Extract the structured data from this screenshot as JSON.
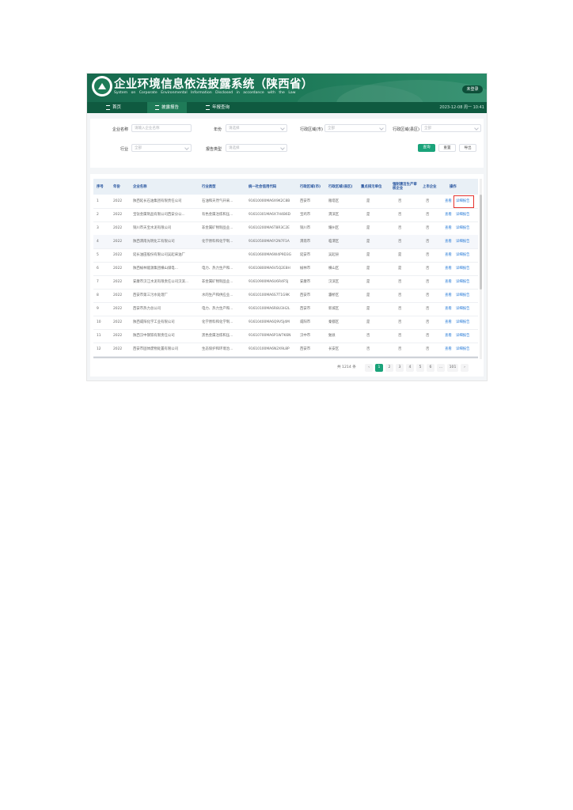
{
  "header": {
    "title": "企业环境信息依法披露系统（陕西省）",
    "subtitle": "System on Corporate Environmental Information Disclosed in accordance with the Law",
    "login_label": "未登录"
  },
  "nav": {
    "items": [
      {
        "label": "首页",
        "active": false
      },
      {
        "label": "披露报告",
        "active": true
      },
      {
        "label": "年报查询",
        "active": false
      }
    ],
    "datetime": "2023-12-08 周一 10:41"
  },
  "filters": {
    "company_name_label": "企业名称",
    "company_name_placeholder": "请输入企业名称",
    "year_label": "年份",
    "year_value": "请选择",
    "region_city_label": "行政区域(市)",
    "region_city_value": "全部",
    "region_county_label": "行政区域(县区)",
    "region_county_value": "全部",
    "industry_label": "行业",
    "industry_value": "全部",
    "report_type_label": "报告类型",
    "report_type_value": "请选择",
    "search_button": "查询",
    "reset_button": "重置",
    "export_button": "导出"
  },
  "table": {
    "columns": [
      "序号",
      "年份",
      "企业名称",
      "行业类型",
      "统一社会信用代码",
      "行政区域(市)",
      "行政区域(县区)",
      "重点排污单位",
      "强制清洁生产审核企业",
      "上市企业",
      "操作"
    ],
    "op_view": "查看",
    "op_detail": "详细报告",
    "rows": [
      {
        "no": "1",
        "year": "2022",
        "name": "陕西延长石油集团有限责任公司",
        "industry": "石油和天然气开采...",
        "code": "91610000MA6X9K2C8B",
        "city": "西安市",
        "county": "雁塔区",
        "key": "是",
        "clean": "否",
        "listed": "否"
      },
      {
        "no": "2",
        "year": "2022",
        "name": "宝钛金属制品有限公司西安分公...",
        "industry": "有色金属冶炼和压...",
        "code": "91610301MA6X7H4B6D",
        "city": "宝鸡市",
        "county": "渭滨区",
        "key": "是",
        "clean": "否",
        "listed": "否"
      },
      {
        "no": "3",
        "year": "2022",
        "name": "铜川市天宝水泥有限公司",
        "industry": "非金属矿物制品业...",
        "code": "91610200MA6T8R3C2E",
        "city": "铜川市",
        "county": "耀州区",
        "key": "是",
        "clean": "否",
        "listed": "否"
      },
      {
        "no": "4",
        "year": "2022",
        "name": "陕西渭南光明化工有限公司",
        "industry": "化学原料和化学制...",
        "code": "91610500MA6Y2N7F1A",
        "city": "渭南市",
        "county": "临渭区",
        "key": "是",
        "clean": "否",
        "listed": "否"
      },
      {
        "no": "5",
        "year": "2022",
        "name": "延长油田股份有限公司吴起采油厂",
        "industry": "",
        "code": "91610600MA6W4P9D3G",
        "city": "延安市",
        "county": "吴起县",
        "key": "是",
        "clean": "是",
        "listed": "否"
      },
      {
        "no": "6",
        "year": "2022",
        "name": "陕西榆林能源集团横山煤电...",
        "industry": "电力、热力生产和...",
        "code": "91610800MA6V5Q2E8H",
        "city": "榆林市",
        "county": "横山区",
        "key": "是",
        "clean": "是",
        "listed": "否"
      },
      {
        "no": "7",
        "year": "2022",
        "name": "安康市汉江水泥有限责任公司汉滨...",
        "industry": "非金属矿物制品业...",
        "code": "91610900MA6U6R4F5J",
        "city": "安康市",
        "county": "汉滨区",
        "key": "是",
        "clean": "否",
        "listed": "否"
      },
      {
        "no": "8",
        "year": "2022",
        "name": "西安市第三污水处理厂",
        "industry": "水的生产和供应业...",
        "code": "91610100MA6S7T1G9K",
        "city": "西安市",
        "county": "灞桥区",
        "key": "是",
        "clean": "否",
        "listed": "否"
      },
      {
        "no": "9",
        "year": "2022",
        "name": "西安市热力总公司",
        "industry": "电力、热力生产和...",
        "code": "91610100MA6R8U3H2L",
        "city": "西安市",
        "county": "新城区",
        "key": "是",
        "clean": "否",
        "listed": "否"
      },
      {
        "no": "10",
        "year": "2022",
        "name": "陕西咸阳化学工业有限公司",
        "industry": "化学原料和化学制...",
        "code": "91610400MA6Q9V5J4M",
        "city": "咸阳市",
        "county": "秦都区",
        "key": "是",
        "clean": "否",
        "listed": "否"
      },
      {
        "no": "11",
        "year": "2022",
        "name": "陕西汉中钢铁有限责任公司",
        "industry": "黑色金属冶炼和压...",
        "code": "91610700MA6P1W7K6N",
        "city": "汉中市",
        "county": "勉县",
        "key": "否",
        "clean": "否",
        "listed": "否"
      },
      {
        "no": "12",
        "year": "2022",
        "name": "西安市固体废物处置有限公司",
        "industry": "生态保护和环境治...",
        "code": "91610100MA6N2X9L8P",
        "city": "西安市",
        "county": "长安区",
        "key": "否",
        "clean": "否",
        "listed": "否"
      }
    ]
  },
  "pagination": {
    "total_label": "共 1214 条",
    "pages": [
      "1",
      "2",
      "3",
      "4",
      "5",
      "6",
      "...",
      "101"
    ],
    "prev": "‹",
    "next": "›"
  },
  "colors": {
    "brand": "#1e7a59",
    "nav_bg": "#0f5a40",
    "primary_button": "#1aa37a",
    "link": "#2f7fd8",
    "highlight": "#e5322d"
  }
}
